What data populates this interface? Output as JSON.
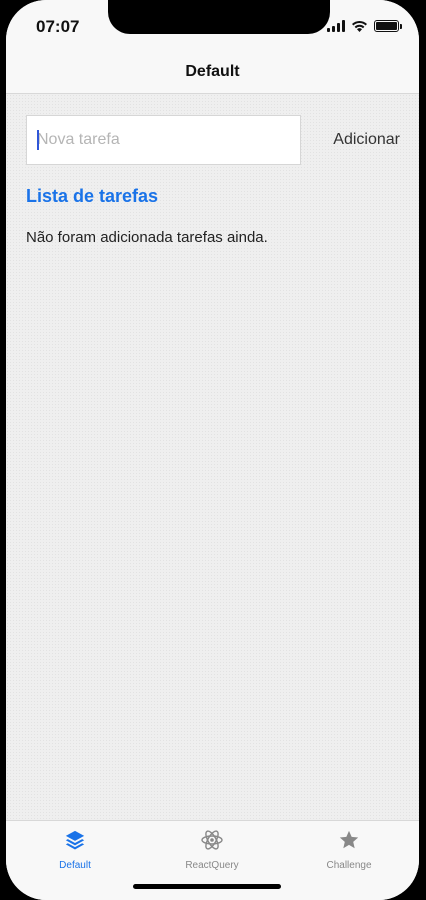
{
  "status": {
    "time": "07:07"
  },
  "navbar": {
    "title": "Default"
  },
  "form": {
    "placeholder": "Nova tarefa",
    "value": "",
    "add_label": "Adicionar"
  },
  "list": {
    "title": "Lista de tarefas",
    "empty_message": "Não foram adicionada tarefas ainda.",
    "items": []
  },
  "tabs": [
    {
      "label": "Default",
      "icon": "layers-icon",
      "active": true
    },
    {
      "label": "ReactQuery",
      "icon": "react-atom-icon",
      "active": false
    },
    {
      "label": "Challenge",
      "icon": "star-icon",
      "active": false
    }
  ],
  "colors": {
    "accent": "#1a73e8",
    "inactive": "#888888"
  }
}
